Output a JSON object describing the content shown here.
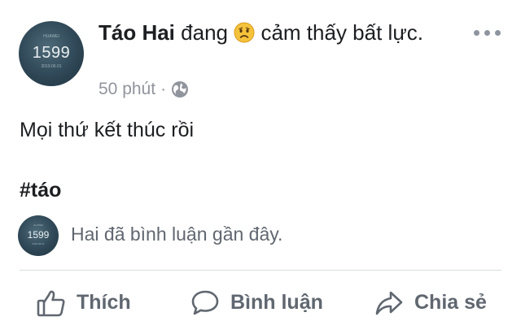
{
  "post": {
    "avatar": {
      "number": "1599",
      "line_top": "HUAWEI",
      "line_bottom": "2019.06.01"
    },
    "author": "Táo Hai",
    "feeling_prefix": "đang",
    "feeling_icon": "sad-face-emoji",
    "feeling_text": "cảm thấy bất lực.",
    "time": "50 phút",
    "separator": "·",
    "privacy_icon": "globe-icon",
    "more_icon": "more-options-icon",
    "text": "Mọi thứ kết thúc rồi",
    "hashtag": "#táo"
  },
  "comment_preview": {
    "avatar": {
      "number": "1599",
      "line_top": "HUAWEI",
      "line_bottom": "2019.06.01"
    },
    "text": "Hai đã bình luận gần đây."
  },
  "actions": {
    "like": {
      "label": "Thích",
      "icon": "thumbs-up-icon"
    },
    "comment": {
      "label": "Bình luận",
      "icon": "speech-bubble-icon"
    },
    "share": {
      "label": "Chia sẻ",
      "icon": "share-arrow-icon"
    }
  },
  "colors": {
    "text": "#1c1e21",
    "secondary_text": "#90949c",
    "action_text": "#606770",
    "divider": "#dadde1",
    "emoji_yellow": "#f5c33b"
  }
}
